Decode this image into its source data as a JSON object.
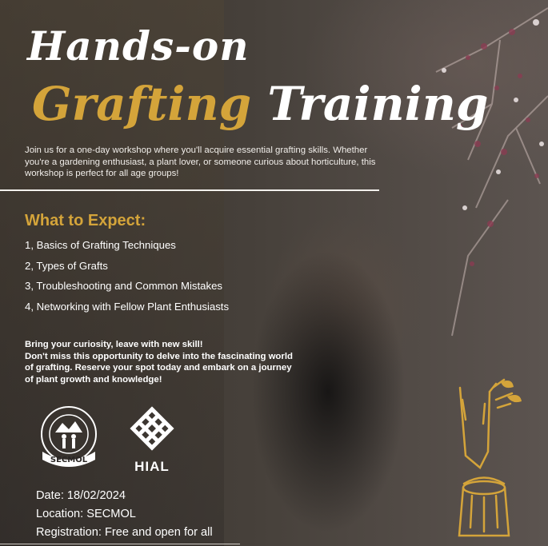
{
  "title": {
    "line1": "Hands-on",
    "line2_accent": "Grafting",
    "line2_rest": "Training"
  },
  "intro": "Join us for a one-day workshop where you'll acquire essential grafting skills. Whether you're a gardening enthusiast, a plant lover, or someone curious about horticulture, this workshop is perfect for all age groups!",
  "expect": {
    "heading": "What to Expect:",
    "items": [
      "1, Basics of Grafting Techniques",
      "2, Types of Grafts",
      "3, Troubleshooting and Common Mistakes",
      "4, Networking with Fellow Plant Enthusiasts"
    ]
  },
  "tagline": {
    "line1": "Bring your curiosity, leave with new skill!",
    "line2": "Don't miss this opportunity to delve into the fascinating world of grafting. Reserve your spot today and embark on a journey of plant growth and knowledge!"
  },
  "logos": {
    "secmol": "SECMOL",
    "hial": "HIAL"
  },
  "details": {
    "date": "Date: 18/02/2024",
    "location": "Location: SECMOL",
    "registration": "Registration: Free and open for all"
  },
  "colors": {
    "accent": "#d4a43a",
    "text": "#ffffff"
  }
}
